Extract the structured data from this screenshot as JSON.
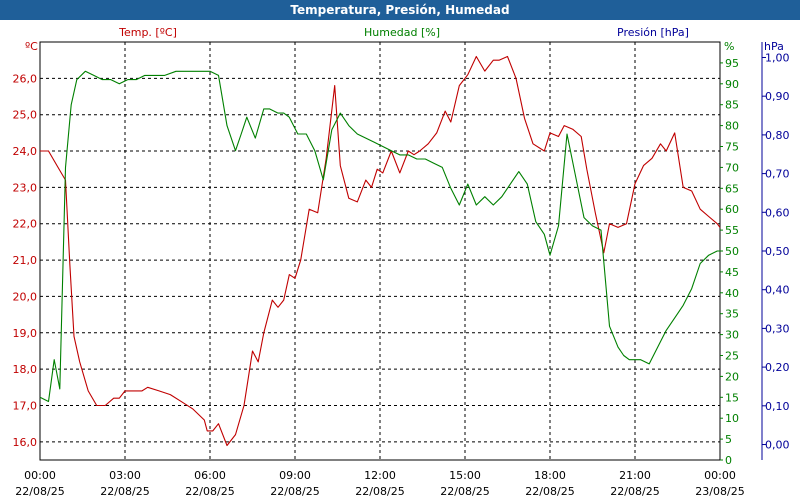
{
  "window": {
    "title": "Temperatura, Presión, Humedad"
  },
  "chart_data": {
    "type": "line",
    "title": "Temperatura, Presión, Humedad",
    "grid": true,
    "colors": {
      "temp": "#c00000",
      "hum": "#008000",
      "pres": "#000099",
      "titlebar": "#1f5f99"
    },
    "axes": {
      "left": {
        "label": "Temp. [ºC]",
        "unit": "ºC",
        "color": "#c00000",
        "range": [
          15.5,
          27.0
        ],
        "ticks": [
          16.0,
          17.0,
          18.0,
          19.0,
          20.0,
          21.0,
          22.0,
          23.0,
          24.0,
          25.0,
          26.0
        ],
        "tick_labels": [
          "16,0",
          "17,0",
          "18,0",
          "19,0",
          "20,0",
          "21,0",
          "22,0",
          "23,0",
          "24,0",
          "25,0",
          "26,0"
        ]
      },
      "right_humidity": {
        "label": "Humedad [%]",
        "unit": "%",
        "color": "#008000",
        "range": [
          0,
          100
        ],
        "ticks": [
          0,
          5,
          10,
          15,
          20,
          25,
          30,
          35,
          40,
          45,
          50,
          55,
          60,
          65,
          70,
          75,
          80,
          85,
          90,
          95
        ],
        "tick_labels": [
          "0",
          "5",
          "10",
          "15",
          "20",
          "25",
          "30",
          "35",
          "40",
          "45",
          "50",
          "55",
          "60",
          "65",
          "70",
          "75",
          "80",
          "85",
          "90",
          "95"
        ]
      },
      "right_pressure": {
        "label": "Presión [hPa]",
        "unit": "hPa",
        "color": "#000099",
        "range": [
          -0.04,
          1.04
        ],
        "ticks": [
          0.0,
          0.1,
          0.2,
          0.3,
          0.4,
          0.5,
          0.6,
          0.7,
          0.8,
          0.9,
          1.0
        ],
        "tick_labels": [
          "0,00",
          "0,10",
          "0,20",
          "0,30",
          "0,40",
          "0,50",
          "0,60",
          "0,70",
          "0,80",
          "0,90",
          "1,00"
        ]
      },
      "x": {
        "range_hours": [
          0,
          24
        ],
        "ticks_hours": [
          0,
          3,
          6,
          9,
          12,
          15,
          18,
          21,
          24
        ],
        "tick_labels": [
          {
            "time": "00:00",
            "date": "22/08/25"
          },
          {
            "time": "03:00",
            "date": "22/08/25"
          },
          {
            "time": "06:00",
            "date": "22/08/25"
          },
          {
            "time": "09:00",
            "date": "22/08/25"
          },
          {
            "time": "12:00",
            "date": "22/08/25"
          },
          {
            "time": "15:00",
            "date": "22/08/25"
          },
          {
            "time": "18:00",
            "date": "22/08/25"
          },
          {
            "time": "21:00",
            "date": "22/08/25"
          },
          {
            "time": "00:00",
            "date": "23/08/25"
          }
        ]
      }
    },
    "series": [
      {
        "name": "Temp. [ºC]",
        "axis": "left",
        "x": [
          0,
          0.3,
          0.6,
          0.9,
          1.05,
          1.2,
          1.4,
          1.7,
          2.0,
          2.3,
          2.6,
          2.8,
          3.0,
          3.3,
          3.6,
          3.8,
          4.2,
          4.6,
          5.0,
          5.4,
          5.8,
          5.9,
          6.1,
          6.3,
          6.6,
          6.9,
          7.2,
          7.5,
          7.7,
          7.9,
          8.2,
          8.4,
          8.6,
          8.8,
          9.0,
          9.2,
          9.5,
          9.8,
          10.1,
          10.4,
          10.6,
          10.9,
          11.2,
          11.5,
          11.7,
          11.9,
          12.1,
          12.4,
          12.7,
          13.0,
          13.2,
          13.4,
          13.7,
          14.0,
          14.3,
          14.5,
          14.8,
          15.1,
          15.4,
          15.7,
          16.0,
          16.2,
          16.5,
          16.8,
          17.1,
          17.4,
          17.8,
          18.0,
          18.3,
          18.5,
          18.8,
          19.1,
          19.3,
          19.6,
          19.9,
          20.1,
          20.4,
          20.7,
          21.0,
          21.3,
          21.6,
          21.9,
          22.1,
          22.4,
          22.7,
          23.0,
          23.3,
          23.6,
          23.9,
          24.0
        ],
        "y": [
          24.0,
          24.0,
          23.6,
          23.2,
          20.9,
          18.9,
          18.2,
          17.4,
          17.0,
          17.0,
          17.2,
          17.2,
          17.4,
          17.4,
          17.4,
          17.5,
          17.4,
          17.3,
          17.1,
          16.9,
          16.6,
          16.3,
          16.3,
          16.5,
          15.9,
          16.2,
          17.0,
          18.5,
          18.2,
          19.0,
          19.9,
          19.7,
          19.9,
          20.6,
          20.5,
          21.0,
          22.4,
          22.3,
          23.8,
          25.8,
          23.6,
          22.7,
          22.6,
          23.2,
          23.0,
          23.5,
          23.4,
          24.0,
          23.4,
          24.0,
          23.9,
          24.0,
          24.2,
          24.5,
          25.1,
          24.8,
          25.8,
          26.1,
          26.6,
          26.2,
          26.5,
          26.5,
          26.6,
          26.0,
          24.9,
          24.2,
          24.0,
          24.5,
          24.4,
          24.7,
          24.6,
          24.4,
          23.5,
          22.3,
          21.2,
          22.0,
          21.9,
          22.0,
          23.1,
          23.6,
          23.8,
          24.2,
          24.0,
          24.5,
          23.0,
          22.9,
          22.4,
          22.2,
          22.0,
          21.9
        ]
      },
      {
        "name": "Humedad [%]",
        "axis": "right_humidity",
        "x": [
          0,
          0.3,
          0.5,
          0.7,
          0.9,
          1.1,
          1.3,
          1.6,
          1.9,
          2.2,
          2.5,
          2.8,
          3.1,
          3.4,
          3.7,
          4.0,
          4.4,
          4.8,
          5.2,
          5.6,
          6.0,
          6.3,
          6.6,
          6.9,
          7.1,
          7.3,
          7.6,
          7.9,
          8.1,
          8.4,
          8.6,
          8.8,
          9.1,
          9.4,
          9.7,
          10.0,
          10.3,
          10.6,
          10.9,
          11.2,
          11.5,
          11.8,
          12.1,
          12.4,
          12.7,
          13.0,
          13.3,
          13.6,
          13.9,
          14.2,
          14.5,
          14.8,
          15.1,
          15.4,
          15.7,
          16.0,
          16.3,
          16.6,
          16.9,
          17.2,
          17.5,
          17.8,
          18.0,
          18.3,
          18.6,
          18.9,
          19.2,
          19.5,
          19.8,
          20.1,
          20.4,
          20.6,
          20.8,
          21.0,
          21.2,
          21.5,
          21.8,
          22.1,
          22.4,
          22.7,
          23.0,
          23.3,
          23.6,
          23.9,
          24.0
        ],
        "y": [
          15,
          14,
          24,
          17,
          70,
          85,
          91,
          93,
          92,
          91,
          91,
          90,
          91,
          91,
          92,
          92,
          92,
          93,
          93,
          93,
          93,
          92,
          80,
          74,
          78,
          82,
          77,
          84,
          84,
          83,
          83,
          82,
          78,
          78,
          74,
          67,
          79,
          83,
          80,
          78,
          77,
          76,
          75,
          74,
          73,
          73,
          72,
          72,
          71,
          70,
          65,
          61,
          66,
          61,
          63,
          61,
          63,
          66,
          69,
          66,
          57,
          54,
          49,
          56,
          78,
          68,
          58,
          56,
          55,
          32,
          27,
          25,
          24,
          24,
          24,
          23,
          27,
          31,
          34,
          37,
          41,
          47,
          49,
          50,
          50
        ]
      },
      {
        "name": "Presión [hPa]",
        "axis": "right_pressure",
        "x": [],
        "y": []
      }
    ]
  }
}
